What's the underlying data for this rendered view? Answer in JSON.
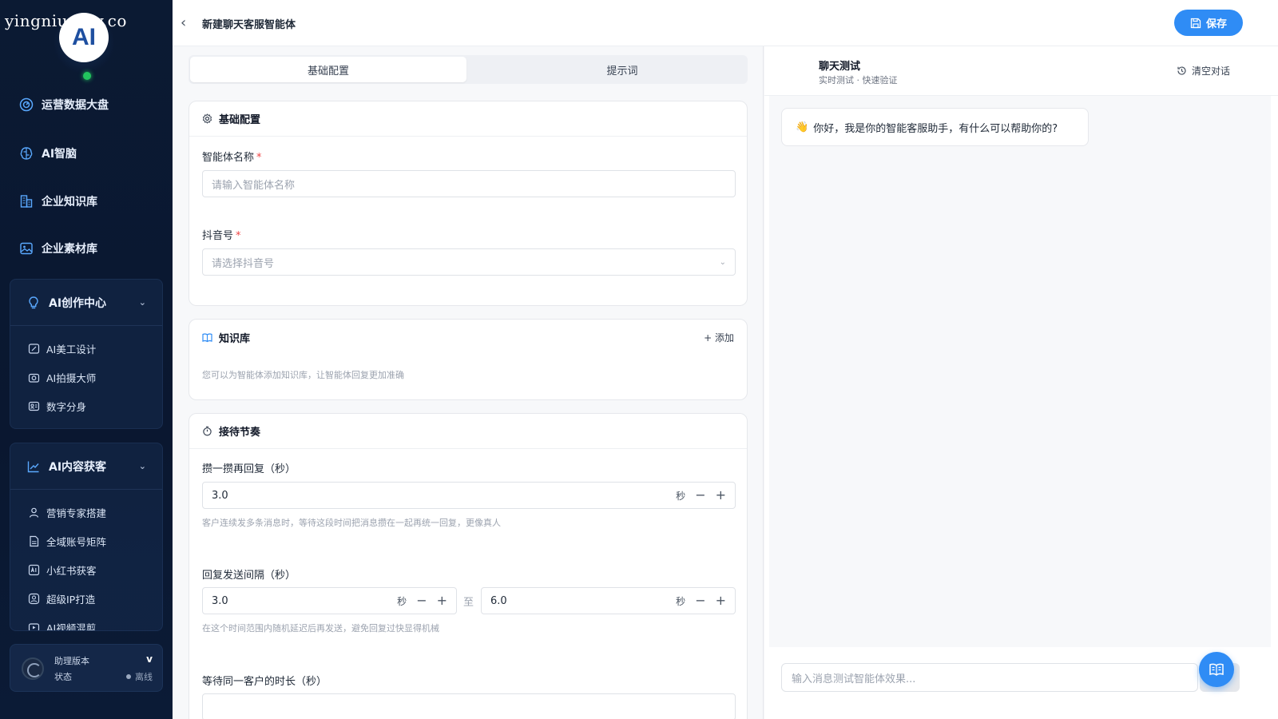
{
  "watermark": "yingniu.10v.co",
  "logo_text": "AI",
  "sidebar": {
    "items": [
      {
        "label": "运营数据大盘",
        "icon": "dashboard-icon"
      },
      {
        "label": "AI智脑",
        "icon": "brain-icon"
      },
      {
        "label": "企业知识库",
        "icon": "building-icon"
      },
      {
        "label": "企业素材库",
        "icon": "image-icon"
      }
    ],
    "groups": [
      {
        "label": "AI创作中心",
        "icon": "lightbulb-icon",
        "items": [
          {
            "label": "AI美工设计",
            "icon": "design-icon"
          },
          {
            "label": "AI拍摄大师",
            "icon": "camera-icon"
          },
          {
            "label": "数字分身",
            "icon": "avatar-card-icon"
          }
        ]
      },
      {
        "label": "AI内容获客",
        "icon": "trend-chart-icon",
        "items": [
          {
            "label": "营销专家搭建",
            "icon": "user-icon"
          },
          {
            "label": "全域账号矩阵",
            "icon": "document-icon"
          },
          {
            "label": "小红书获客",
            "icon": "ai-badge-icon"
          },
          {
            "label": "超级IP打造",
            "icon": "id-card-icon"
          },
          {
            "label": "AI视频混剪",
            "icon": "video-icon"
          }
        ]
      }
    ],
    "status": {
      "title": "助理版本",
      "version": "v",
      "label": "状态",
      "state": "离线"
    }
  },
  "header": {
    "title": "新建聊天客服智能体",
    "save_label": "保存"
  },
  "tabs": [
    "基础配置",
    "提示词"
  ],
  "basic": {
    "title": "基础配置",
    "name_label": "智能体名称",
    "name_placeholder": "请输入智能体名称",
    "douyin_label": "抖音号",
    "douyin_placeholder": "请选择抖音号",
    "required_mark": "*"
  },
  "knowledge": {
    "title": "知识库",
    "add_label": "+ 添加",
    "hint": "您可以为智能体添加知识库，让智能体回复更加准确"
  },
  "rhythm": {
    "title": "接待节奏",
    "merge_label": "攒一攒再回复（秒）",
    "merge_value": "3.0",
    "merge_hint": "客户连续发多条消息时，等待这段时间把消息攒在一起再统一回复，更像真人",
    "interval_label": "回复发送间隔（秒）",
    "interval_min": "3.0",
    "interval_max": "6.0",
    "interval_to": "至",
    "interval_hint": "在这个时间范围内随机延迟后再发送，避免回复过快显得机械",
    "wait_label": "等待同一客户的时长（秒）",
    "unit": "秒",
    "minus": "−",
    "plus": "+"
  },
  "chat": {
    "title": "聊天测试",
    "subtitle": "实时测试 · 快速验证",
    "clear_label": "清空对话",
    "greeting_emoji": "👋",
    "greeting": "你好，我是你的智能客服助手，有什么可以帮助你的?",
    "input_placeholder": "输入消息测试智能体效果..."
  },
  "colors": {
    "primary": "#2f8cf5",
    "sidebar_bg": "#0b1a33",
    "online": "#22c55e",
    "required": "#ef4444"
  }
}
